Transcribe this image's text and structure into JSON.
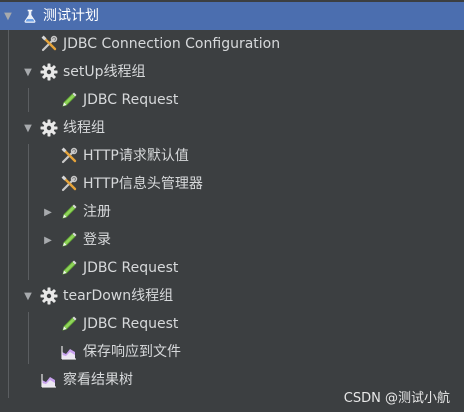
{
  "tree": {
    "items": [
      {
        "label": "测试计划",
        "icon": "test-plan-icon",
        "expanded": true,
        "selected": true
      },
      {
        "label": "JDBC Connection Configuration",
        "icon": "config-tools-icon"
      },
      {
        "label": "setUp线程组",
        "icon": "thread-group-gear-icon",
        "expanded": true
      },
      {
        "label": "JDBC Request",
        "icon": "sampler-pen-icon"
      },
      {
        "label": "线程组",
        "icon": "thread-group-gear-icon",
        "expanded": true
      },
      {
        "label": "HTTP请求默认值",
        "icon": "config-tools-icon"
      },
      {
        "label": "HTTP信息头管理器",
        "icon": "config-tools-icon"
      },
      {
        "label": "注册",
        "icon": "sampler-pen-icon",
        "expanded": false
      },
      {
        "label": "登录",
        "icon": "sampler-pen-icon",
        "expanded": false
      },
      {
        "label": "JDBC Request",
        "icon": "sampler-pen-icon"
      },
      {
        "label": "tearDown线程组",
        "icon": "thread-group-gear-icon",
        "expanded": true
      },
      {
        "label": "JDBC Request",
        "icon": "sampler-pen-icon"
      },
      {
        "label": "保存响应到文件",
        "icon": "listener-chart-icon"
      },
      {
        "label": "察看结果树",
        "icon": "listener-chart-icon"
      }
    ]
  },
  "watermark": "CSDN @测试小航",
  "colors": {
    "background": "#3c3f41",
    "selection": "#4b6eaf",
    "text": "#d7d9db",
    "guide": "#5b5e61"
  }
}
